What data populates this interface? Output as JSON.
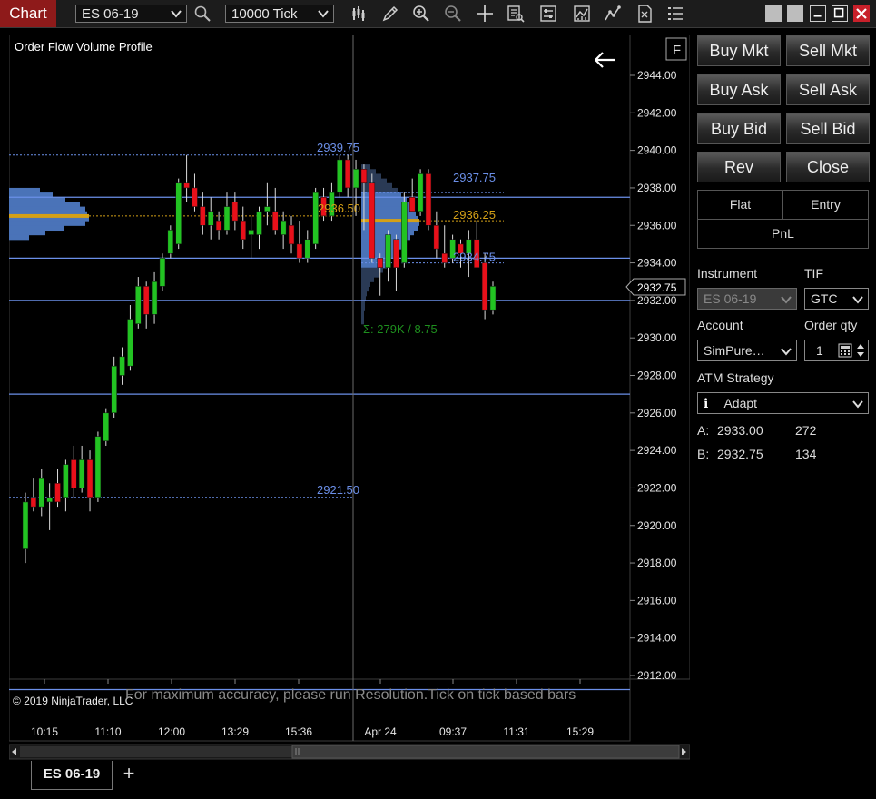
{
  "toolbar": {
    "title": "Chart",
    "instrument": "ES 06-19",
    "interval": "10000 Tick",
    "icons": [
      "search-icon",
      "bar-style-icon",
      "draw-pencil-icon",
      "zoom-in-icon",
      "zoom-out-icon",
      "crosshair-icon",
      "data-box-icon",
      "properties-icon",
      "indicators-icon",
      "strategies-icon",
      "templates-icon",
      "list-icon"
    ]
  },
  "chart": {
    "title": "Order Flow Volume Profile",
    "f_button": "F",
    "copyright": "© 2019 NinjaTrader, LLC",
    "resolution_notice": "For maximum accuracy, please run Resolution.Tick on tick based bars",
    "price_tag": "2932.75",
    "profile_summary": "Σ: 279K / 8.75",
    "level_labels": {
      "high": "2939.75",
      "vah": "2937.75",
      "poc_left": "2936.50",
      "poc_right": "2936.25",
      "val_right": "2934.75",
      "low": "2921.50"
    },
    "time_labels": [
      "10:15",
      "11:10",
      "12:00",
      "13:29",
      "15:36",
      "Apr 24",
      "09:37",
      "11:31",
      "15:29"
    ],
    "colors": {
      "up": "#22c322",
      "down": "#e8101a",
      "profile": "#4a73b8",
      "poc": "#d4a017",
      "line": "#6b8fe8"
    }
  },
  "chart_data": {
    "type": "candlestick",
    "instrument": "ES 06-19",
    "interval": "10000 Tick",
    "ylim": [
      2910,
      2946
    ],
    "y_ticks": [
      2944.0,
      2942.0,
      2940.0,
      2938.0,
      2936.0,
      2934.0,
      2932.0,
      2930.0,
      2928.0,
      2926.0,
      2924.0,
      2922.0,
      2920.0,
      2918.0,
      2916.0,
      2914.0,
      2912.0
    ],
    "horizontal_lines": [
      2937.5,
      2934.25,
      2932.0,
      2927.0,
      2911.25
    ],
    "candles": [
      {
        "o": 2918.75,
        "h": 2921.75,
        "l": 2918.0,
        "c": 2921.25
      },
      {
        "o": 2921.5,
        "h": 2922.5,
        "l": 2920.75,
        "c": 2921.0
      },
      {
        "o": 2921.0,
        "h": 2923.0,
        "l": 2920.5,
        "c": 2922.5
      },
      {
        "o": 2921.25,
        "h": 2922.25,
        "l": 2919.75,
        "c": 2921.5
      },
      {
        "o": 2922.25,
        "h": 2923.0,
        "l": 2921.0,
        "c": 2921.25
      },
      {
        "o": 2921.5,
        "h": 2923.5,
        "l": 2920.75,
        "c": 2923.25
      },
      {
        "o": 2923.5,
        "h": 2924.25,
        "l": 2921.5,
        "c": 2922.0
      },
      {
        "o": 2922.0,
        "h": 2924.25,
        "l": 2921.75,
        "c": 2923.5
      },
      {
        "o": 2923.5,
        "h": 2924.0,
        "l": 2920.75,
        "c": 2921.5
      },
      {
        "o": 2921.5,
        "h": 2925.0,
        "l": 2921.25,
        "c": 2924.75
      },
      {
        "o": 2924.5,
        "h": 2926.25,
        "l": 2924.25,
        "c": 2926.0
      },
      {
        "o": 2926.0,
        "h": 2929.0,
        "l": 2925.75,
        "c": 2928.5
      },
      {
        "o": 2928.0,
        "h": 2929.5,
        "l": 2927.5,
        "c": 2929.0
      },
      {
        "o": 2928.5,
        "h": 2931.75,
        "l": 2928.25,
        "c": 2931.0
      },
      {
        "o": 2930.75,
        "h": 2933.25,
        "l": 2930.5,
        "c": 2932.75
      },
      {
        "o": 2932.75,
        "h": 2933.0,
        "l": 2930.5,
        "c": 2931.25
      },
      {
        "o": 2931.25,
        "h": 2933.5,
        "l": 2930.75,
        "c": 2933.0
      },
      {
        "o": 2932.75,
        "h": 2934.5,
        "l": 2932.5,
        "c": 2934.25
      },
      {
        "o": 2934.5,
        "h": 2936.0,
        "l": 2934.25,
        "c": 2935.75
      },
      {
        "o": 2935.0,
        "h": 2938.5,
        "l": 2934.75,
        "c": 2938.25
      },
      {
        "o": 2938.25,
        "h": 2939.75,
        "l": 2937.25,
        "c": 2938.0
      },
      {
        "o": 2938.0,
        "h": 2938.75,
        "l": 2936.75,
        "c": 2937.0
      },
      {
        "o": 2937.0,
        "h": 2937.75,
        "l": 2935.5,
        "c": 2936.0
      },
      {
        "o": 2936.0,
        "h": 2937.5,
        "l": 2935.25,
        "c": 2936.75
      },
      {
        "o": 2936.25,
        "h": 2936.75,
        "l": 2935.25,
        "c": 2935.75
      },
      {
        "o": 2935.75,
        "h": 2937.75,
        "l": 2935.5,
        "c": 2937.0
      },
      {
        "o": 2937.25,
        "h": 2937.75,
        "l": 2935.75,
        "c": 2936.25
      },
      {
        "o": 2936.25,
        "h": 2937.0,
        "l": 2934.75,
        "c": 2935.25
      },
      {
        "o": 2935.5,
        "h": 2936.5,
        "l": 2934.25,
        "c": 2935.75
      },
      {
        "o": 2935.5,
        "h": 2937.0,
        "l": 2934.75,
        "c": 2936.75
      },
      {
        "o": 2936.75,
        "h": 2938.25,
        "l": 2936.0,
        "c": 2937.0
      },
      {
        "o": 2936.75,
        "h": 2938.0,
        "l": 2935.5,
        "c": 2935.75
      },
      {
        "o": 2935.5,
        "h": 2936.75,
        "l": 2934.75,
        "c": 2936.25
      },
      {
        "o": 2936.0,
        "h": 2936.5,
        "l": 2934.5,
        "c": 2935.0
      },
      {
        "o": 2935.0,
        "h": 2936.25,
        "l": 2934.0,
        "c": 2934.25
      },
      {
        "o": 2934.25,
        "h": 2935.75,
        "l": 2934.0,
        "c": 2935.25
      },
      {
        "o": 2935.0,
        "h": 2938.0,
        "l": 2934.75,
        "c": 2937.75
      },
      {
        "o": 2937.5,
        "h": 2938.0,
        "l": 2936.25,
        "c": 2936.5
      },
      {
        "o": 2936.5,
        "h": 2938.25,
        "l": 2936.25,
        "c": 2937.75
      },
      {
        "o": 2937.75,
        "h": 2939.75,
        "l": 2937.5,
        "c": 2939.5
      },
      {
        "o": 2939.5,
        "h": 2939.75,
        "l": 2937.5,
        "c": 2938.0
      },
      {
        "o": 2938.0,
        "h": 2939.5,
        "l": 2936.5,
        "c": 2939.0
      },
      {
        "o": 2939.0,
        "h": 2939.25,
        "l": 2935.75,
        "c": 2938.25
      },
      {
        "o": 2938.25,
        "h": 2938.75,
        "l": 2934.0,
        "c": 2934.25
      },
      {
        "o": 2934.25,
        "h": 2934.5,
        "l": 2932.25,
        "c": 2933.75
      },
      {
        "o": 2933.75,
        "h": 2935.75,
        "l": 2933.0,
        "c": 2935.5
      },
      {
        "o": 2935.25,
        "h": 2935.5,
        "l": 2932.5,
        "c": 2933.75
      },
      {
        "o": 2934.0,
        "h": 2937.75,
        "l": 2933.75,
        "c": 2937.25
      },
      {
        "o": 2937.5,
        "h": 2938.5,
        "l": 2936.75,
        "c": 2936.75
      },
      {
        "o": 2936.75,
        "h": 2939.0,
        "l": 2936.5,
        "c": 2938.75
      },
      {
        "o": 2938.75,
        "h": 2939.0,
        "l": 2935.75,
        "c": 2936.0
      },
      {
        "o": 2936.0,
        "h": 2936.75,
        "l": 2934.25,
        "c": 2934.75
      },
      {
        "o": 2934.5,
        "h": 2936.0,
        "l": 2933.75,
        "c": 2934.0
      },
      {
        "o": 2934.25,
        "h": 2935.5,
        "l": 2934.0,
        "c": 2935.25
      },
      {
        "o": 2935.0,
        "h": 2935.25,
        "l": 2933.75,
        "c": 2934.5
      },
      {
        "o": 2934.5,
        "h": 2935.75,
        "l": 2933.25,
        "c": 2935.25
      },
      {
        "o": 2935.25,
        "h": 2936.25,
        "l": 2933.75,
        "c": 2933.75
      },
      {
        "o": 2934.0,
        "h": 2934.5,
        "l": 2931.0,
        "c": 2931.5
      },
      {
        "o": 2931.5,
        "h": 2933.0,
        "l": 2931.25,
        "c": 2932.75
      }
    ]
  },
  "order_panel": {
    "buttons": [
      "Buy Mkt",
      "Sell Mkt",
      "Buy Ask",
      "Sell Ask",
      "Buy Bid",
      "Sell Bid",
      "Rev",
      "Close"
    ],
    "position": {
      "flat": "Flat",
      "entry": "Entry",
      "pnl": "PnL"
    },
    "instrument_label": "Instrument",
    "instrument_value": "ES 06-19",
    "tif_label": "TIF",
    "tif_value": "GTC",
    "account_label": "Account",
    "account_value": "SimPure…",
    "qty_label": "Order qty",
    "qty_value": "1",
    "atm_label": "ATM Strategy",
    "atm_value": "Adapt",
    "ask_label": "A:",
    "ask_price": "2933.00",
    "ask_size": "272",
    "bid_label": "B:",
    "bid_price": "2932.75",
    "bid_size": "134"
  },
  "tabs": {
    "active": "ES 06-19",
    "add": "+"
  }
}
